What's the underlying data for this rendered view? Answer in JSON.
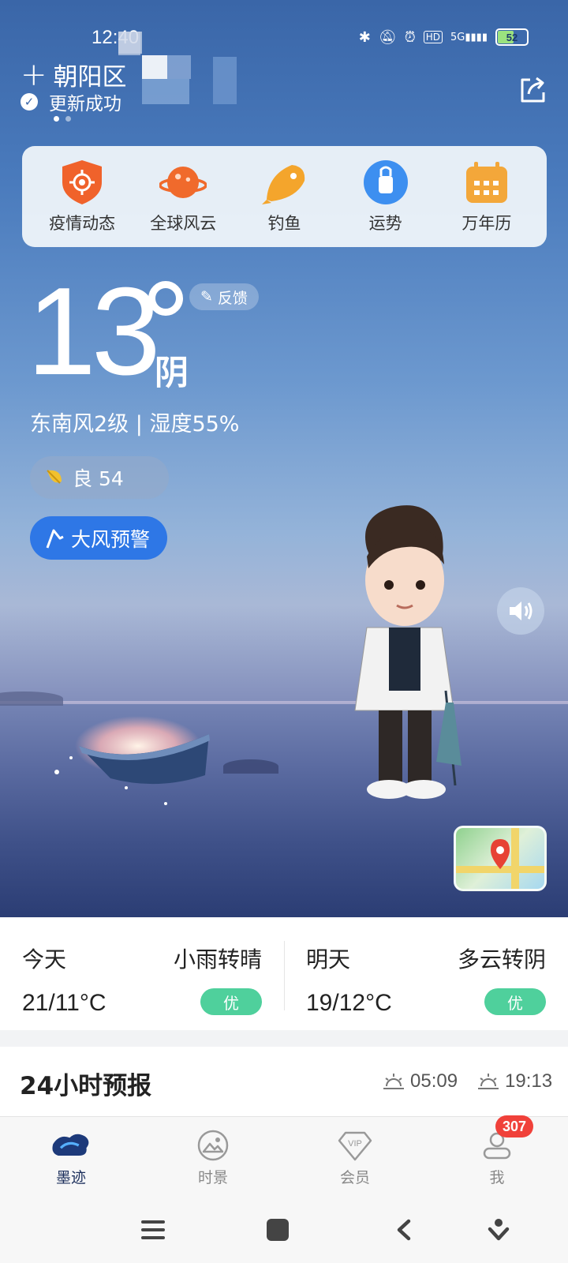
{
  "status_bar": {
    "time": "12:40",
    "battery": "52",
    "network": "5G"
  },
  "location": {
    "name": "朝阳区",
    "update_status": "更新成功"
  },
  "quick_links": [
    {
      "label": "疫情动态",
      "icon": "virus-shield-icon",
      "color": "#f0622b"
    },
    {
      "label": "全球风云",
      "icon": "planet-icon",
      "color": "#f06a2c"
    },
    {
      "label": "钓鱼",
      "icon": "fish-icon",
      "color": "#f4a52c"
    },
    {
      "label": "运势",
      "icon": "fortune-bottle-icon",
      "color": "#3d8ff0"
    },
    {
      "label": "万年历",
      "icon": "calendar-icon",
      "color": "#f3a73a"
    }
  ],
  "current": {
    "temperature": "13",
    "condition": "阴",
    "feedback_label": "反馈",
    "wind_humidity": "东南风2级 | 湿度55%",
    "aqi_label": "良 54",
    "alert_label": "大风预警"
  },
  "forecast": {
    "today": {
      "day": "今天",
      "desc": "小雨转晴",
      "range": "21/11°C",
      "quality": "优"
    },
    "tomorrow": {
      "day": "明天",
      "desc": "多云转阴",
      "range": "19/12°C",
      "quality": "优"
    }
  },
  "hourly": {
    "title": "24小时预报",
    "sunrise": "05:09",
    "sunset": "19:13"
  },
  "tabs": [
    {
      "label": "墨迹",
      "icon": "moji-logo-icon"
    },
    {
      "label": "时景",
      "icon": "picture-icon"
    },
    {
      "label": "会员",
      "icon": "vip-icon"
    },
    {
      "label": "我",
      "icon": "profile-icon",
      "badge": "307"
    }
  ],
  "colors": {
    "accent": "#2e77e6",
    "quality_badge": "#4fd09c",
    "notification": "#f0413a"
  }
}
